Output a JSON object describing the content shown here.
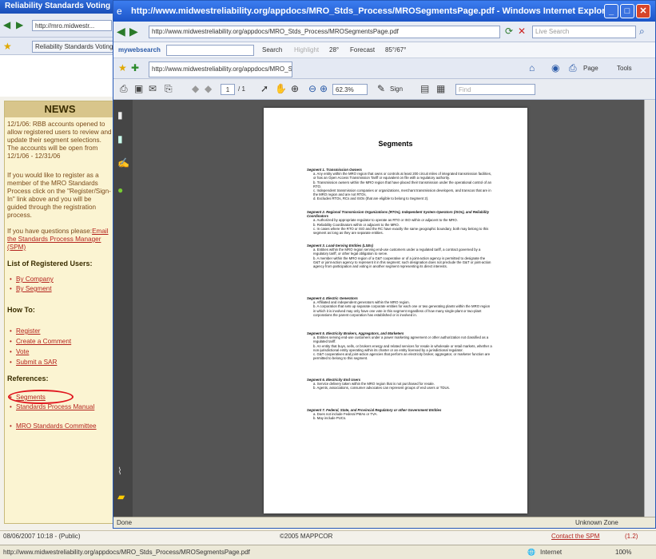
{
  "bg_window": {
    "title": "Reliability Standards Voting Pr...",
    "address_short": "http://mro.midwestr...",
    "tab_label": "Reliability Standards Voting"
  },
  "news": {
    "heading": "NEWS",
    "para1": "12/1/06: RBB accounts opened to allow registered users to review and update their segment selections. The accounts will be open from 12/1/06 - 12/31/06",
    "para2": "If you would like to register as a member of the MRO Standards Process click on the \"Register/Sign-In\" link above and you will be guided through the registration process.",
    "para3_prefix": "If you have questions please:",
    "para3_link": "Email the Standards Process Manager (SPM)",
    "registered_heading": "List of Registered Users:",
    "registered_links": [
      "By Company",
      "By Segment"
    ],
    "howto_heading": "How To:",
    "howto_links": [
      "Register",
      "Create a Comment",
      "Vote",
      "Submit a SAR"
    ],
    "refs_heading": "References:",
    "refs_links": [
      "Segments",
      "Standards Process Manual",
      "MRO Standards Committee"
    ]
  },
  "footer": {
    "timestamp": "08/06/2007 10:18 - (Public)",
    "copyright": "©2005 MAPPCOR",
    "contact": "Contact the SPM",
    "contact_ref": "(1.2)"
  },
  "status": {
    "url": "http://www.midwestreliability.org/appdocs/MRO_Stds_Process/MROSegmentsPage.pdf",
    "zone": "Internet",
    "zoom": "100%"
  },
  "ie": {
    "title": "http://www.midwestreliability.org/appdocs/MRO_Stds_Process/MROSegmentsPage.pdf - Windows Internet Explorer",
    "address": "http://www.midwestreliability.org/appdocs/MRO_Stds_Process/MROSegmentsPage.pdf",
    "live_search": "Live Search",
    "mywebsearch": "mywebsearch",
    "search_btn": "Search",
    "highlight": "Highlight",
    "weather": "28°",
    "forecast": "Forecast",
    "forecast_val": "85°/67°",
    "tab": "http://www.midwestreliability.org/appdocs/MRO_Stds...",
    "page_menu": "Page",
    "tools_menu": "Tools",
    "page_num": "1",
    "page_total": "/ 1",
    "zoom_pct": "62.3%",
    "sign": "Sign",
    "find": "Find",
    "status_done": "Done",
    "status_zone": "Unknown Zone"
  },
  "pdf": {
    "title": "Segments",
    "sections": [
      {
        "heading": "Segment 1. Transmission Owners",
        "items": [
          "a. Any entity within the MRO region that owns or controls at least 200 circuit miles of integrated transmission facilities, or has an Open Access Transmission Tariff or equivalent on file with a regulatory authority.",
          "b. Transmission owners within the MRO region that have placed their transmission under the operational control of an RTO.",
          "c. Independent transmission companies or organizations, merchant transmission developers, and transcos that are in the MRO region and are not RTOs.",
          "d. Excludes RTOs, RCs and ISOs (that are eligible to belong to Segment 2)."
        ]
      },
      {
        "heading": "Segment 2. Regional Transmission Organizations (RTOs), Independent System Operators (ISOs), and Reliability Coordinators",
        "items": [
          "a. Authorized by appropriate regulator to operate as RTO or ISO within or adjacent to the MRO.",
          "b. Reliability Coordinators within or adjacent to the MRO.",
          "c. In cases where the RTO or ISO and the RC have exactly the same geographic boundary, both may belong to this segment as long as they are separate entities."
        ]
      },
      {
        "heading": "Segment 3. Load-Serving Entities (LSEs)",
        "items": [
          "a. Entities within the MRO region serving end-use customers under a regulated tariff, a contract governed by a regulatory tariff, or other legal obligation to serve.",
          "b. A member within the MRO region of a G&T cooperative or of a joint-action agency is permitted to designate the G&T or joint-action agency to represent it in this segment; such designation does not preclude the G&T or joint-action agency from participation and voting in another segment representing its direct interests."
        ]
      },
      {
        "heading": "Segment 4. Electric Generators",
        "items": [
          "a. Affiliated and independent generators within the MRO region.",
          "b. A corporation that sets up separate corporate entities for each one or two generating plants within the MRO region in which it is involved may only have one vote in this segment regardless of how many single-plant or two-plant corporations the parent corporation has established or is involved in."
        ]
      },
      {
        "heading": "Segment 5. Electricity Brokers, Aggregators, and Marketers",
        "items": [
          "a. Entities serving end-use customers under a power marketing agreement or other authorization not classified as a regulated tariff.",
          "b. An entity that buys, sells, or brokers energy and related services for resale in wholesale or retail markets, whether a non-jurisdictional entity operating within its charter or an entity licensed by a jurisdictional regulator.",
          "c. G&T cooperatives and joint-action agencies that perform an electricity broker, aggregator, or marketer function are permitted to belong to this segment."
        ]
      },
      {
        "heading": "Segment 6. Electricity End Users",
        "items": [
          "a. Service delivery taken within the MRO region that is not purchased for resale.",
          "b. Agents, associations, consumer advocates can represent groups of end users or TDUs."
        ]
      },
      {
        "heading": "Segment 7. Federal, State, and Provincial Regulatory or other Government Entities",
        "items": [
          "a. Does not include Federal PMAs or TVA.",
          "b. May include PUCs."
        ]
      }
    ]
  }
}
